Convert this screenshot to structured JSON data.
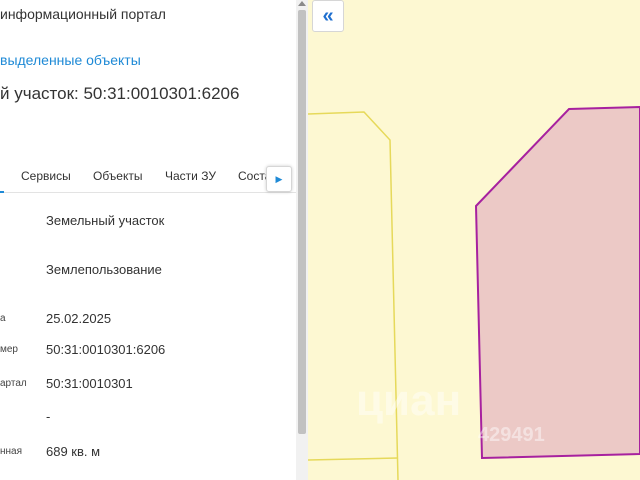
{
  "panel": {
    "portal_title": "информационный портал",
    "back_link": "выделенные объекты",
    "parcel_heading": "й участок: 50:31:0010301:6206"
  },
  "tabs": {
    "items": [
      {
        "label": "Сервисы"
      },
      {
        "label": "Объекты"
      },
      {
        "label": "Части ЗУ"
      },
      {
        "label": "Соста"
      }
    ],
    "scroll_icon": "triangle-right-icon"
  },
  "attributes": [
    {
      "label": "",
      "value": "Земельный участок"
    },
    {
      "label": "",
      "value": "Землепользование"
    },
    {
      "label": "а",
      "value": "25.02.2025"
    },
    {
      "label": "мер",
      "value": "50:31:0010301:6206"
    },
    {
      "label": "артал",
      "value": "50:31:0010301"
    },
    {
      "label": "",
      "value": "-"
    },
    {
      "label": "нная",
      "value": "689 кв. м"
    }
  ],
  "map": {
    "collapse_icon": "double-chevron-left-icon",
    "collapse_glyph": "«",
    "watermark": "циан",
    "watermark_id": "429491",
    "colors": {
      "background": "#fdf8d2",
      "parcel_fill": "#ecc9c6",
      "parcel_stroke": "#a7219f",
      "boundary": "#e6d95a"
    }
  }
}
